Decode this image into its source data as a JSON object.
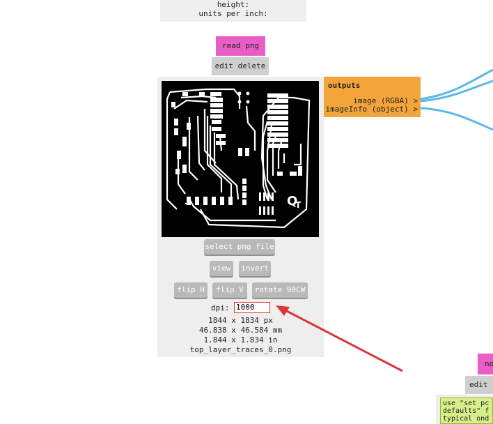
{
  "top_module": {
    "line1": "height:",
    "line2": "units per inch:"
  },
  "read_png_module": {
    "title": "read png",
    "edit_delete": "edit delete",
    "select_button": "select png file",
    "view_button": "view",
    "invert_button": "invert",
    "flip_h_button": "flip H",
    "flip_v_button": "flip V",
    "rotate_button": "rotate 90CW",
    "dpi_label": "dpi:",
    "dpi_value": "1000",
    "size_px": "1844 x 1834 px",
    "size_mm": "46.838 x 46.584 mm",
    "size_in": "1.844 x 1.834 in",
    "filename": "top_layer_traces_0.png"
  },
  "outputs": {
    "header": "outputs",
    "items": [
      "image (RGBA) >",
      "imageInfo (object) >"
    ]
  },
  "partial_module": {
    "title": "no",
    "edit": "edit (",
    "note": "use \"set pc\ndefaults\" f\ntypical ond"
  },
  "colors": {
    "module_title": "#e85ec6",
    "outputs_bg": "#f3a43b",
    "wire": "#5bb8ea",
    "annotation_arrow": "#d9363a",
    "note_bg": "#d6ef8a"
  }
}
